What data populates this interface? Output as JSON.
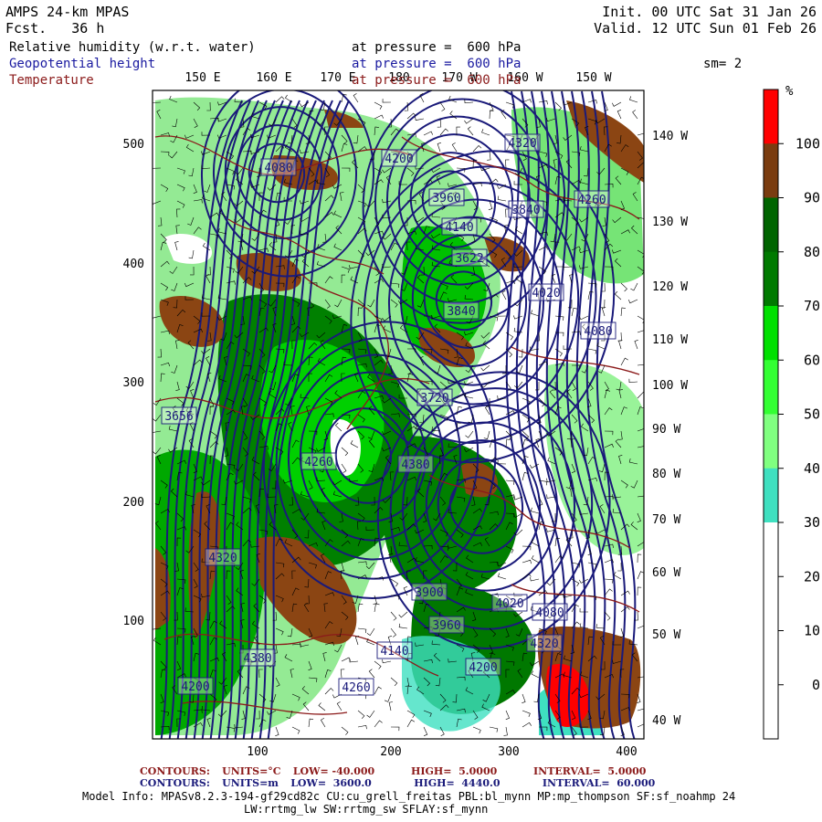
{
  "header": {
    "model": "AMPS 24-km MPAS",
    "fcst_label": "Fcst.",
    "fcst_value": "36 h",
    "init": "Init. 00 UTC Sat 31 Jan 26",
    "valid": "Valid. 12 UTC Sun 01 Feb 26",
    "fields": [
      {
        "name": "Relative humidity (w.r.t. water)",
        "level": "at pressure =  600 hPa",
        "color": "#000000"
      },
      {
        "name": "Geopotential height",
        "level": "at pressure =  600 hPa",
        "color": "#1a1aa0"
      },
      {
        "name": "Temperature",
        "level": "at pressure =  600 hPa",
        "color": "#8b1a1a"
      }
    ],
    "smoothing": "sm= 2"
  },
  "map": {
    "x_ticks": [
      "100",
      "200",
      "300",
      "400"
    ],
    "y_ticks": [
      "100",
      "200",
      "300",
      "400",
      "500"
    ],
    "top_longitudes": [
      "150 E",
      "160 E",
      "170 E",
      "180",
      "170 W",
      "160 W",
      "150 W"
    ],
    "right_longitudes": [
      "140 W",
      "130 W",
      "120 W",
      "110 W",
      "100 W",
      "90 W",
      "80 W",
      "70 W",
      "60 W",
      "50 W",
      "40 W"
    ],
    "height_labels": [
      "4320",
      "4260",
      "4200",
      "4080",
      "3960",
      "4140",
      "3840",
      "3622",
      "4020",
      "3840",
      "3656",
      "3720",
      "4380",
      "4260",
      "4200",
      "4080",
      "4020",
      "4320",
      "3900",
      "3960",
      "4140",
      "4260",
      "4380",
      "4320",
      "4200",
      "4080"
    ],
    "colors": {
      "height_contour": "#1a1a7a",
      "temp_contour": "#8b1a1a",
      "rh_30_40": "#3fe0c0",
      "rh_40_50": "#80f080",
      "rh_50_60": "#3cd83c",
      "rh_60_70": "#00d000",
      "rh_70_80": "#008000",
      "rh_80_90": "#007800",
      "rh_90_100": "#8b4513",
      "rh_100": "#ff0000"
    }
  },
  "colorbar": {
    "unit": "%",
    "ticks": [
      "100",
      "90",
      "80",
      "70",
      "60",
      "50",
      "40",
      "30",
      "20",
      "10",
      "0"
    ],
    "bands": [
      "#ff0000",
      "#7a3c10",
      "#006400",
      "#007a00",
      "#00e000",
      "#33ff33",
      "#80ff80",
      "#3fe0c0",
      "#ffffff",
      "#ffffff",
      "#ffffff",
      "#ffffff"
    ]
  },
  "footer": {
    "temp_contours": {
      "label": "CONTOURS:",
      "units": "UNITS=°C",
      "low": "LOW= -40.000",
      "high": "HIGH=  5.0000",
      "interval": "INTERVAL=  5.0000"
    },
    "height_contours": {
      "label": "CONTOURS:",
      "units": "UNITS=m",
      "low": "LOW=  3600.0",
      "high": "HIGH=  4440.0",
      "interval": "INTERVAL=  60.000"
    },
    "model_info_1": "Model Info: MPASv8.2.3-194-gf29cd82c CU:cu_grell_freitas PBL:bl_mynn MP:mp_thompson SF:sf_noahmp 24",
    "model_info_2": "LW:rrtmg_lw SW:rrtmg_sw SFLAY:sf_mynn"
  }
}
